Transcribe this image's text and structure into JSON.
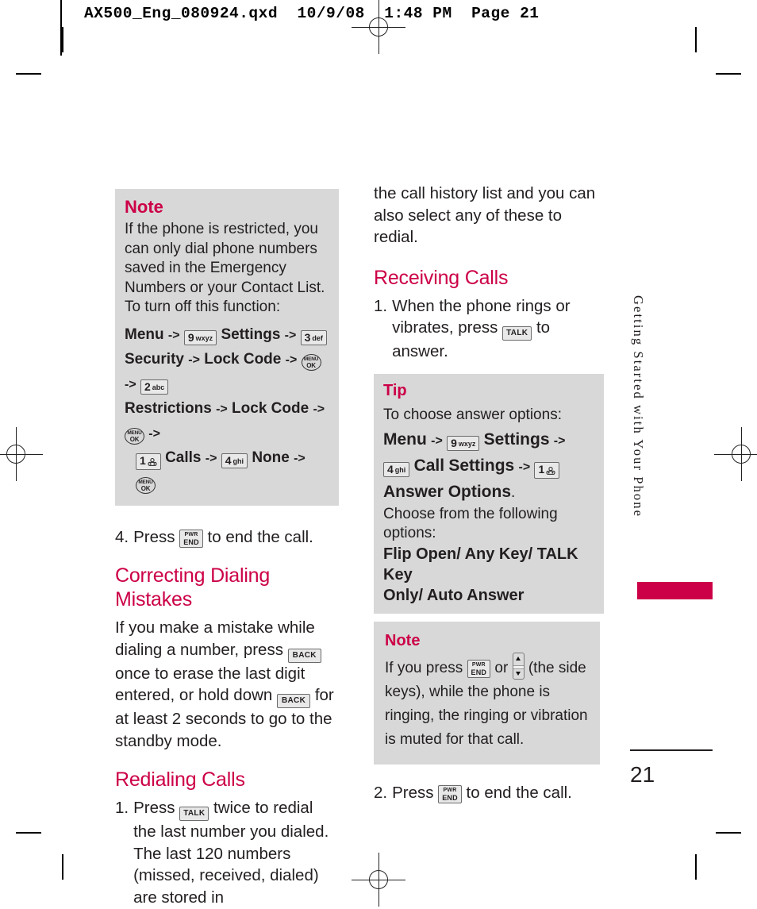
{
  "prepress": {
    "header_line": "AX500_Eng_080924.qxd  10/9/08  1:48 PM  Page 21"
  },
  "left_column": {
    "note_box": {
      "title": "Note",
      "paragraph": "If the phone is restricted, you can only dial phone numbers saved in the Emergency Numbers or your Contact List. To turn off this function:",
      "path_line_1": {
        "menu_label": "Menu",
        "arrow": "->",
        "key_9": {
          "digit": "9",
          "letters": "wxyz"
        },
        "settings_label": "Settings",
        "arrow2": "->",
        "key_3": {
          "digit": "3",
          "letters": "def"
        }
      },
      "path_line_2": {
        "security_label": "Security",
        "arrow": "->",
        "lock_code_label": "Lock Code",
        "arrow2": "->",
        "ok_key": {
          "line1": "MENU",
          "line2": "OK"
        },
        "arrow3": "->",
        "key_2": {
          "digit": "2",
          "letters": "abc"
        }
      },
      "path_line_3": {
        "restrictions_label": "Restrictions",
        "arrow": "->",
        "lock_code_label": "Lock Code",
        "arrow2": "->",
        "ok_key": {
          "line1": "MENU",
          "line2": "OK"
        },
        "arrow3": "->"
      },
      "path_line_4": {
        "key_1": {
          "digit": "1",
          "glyph": "voicemail-icon"
        },
        "calls_label": "Calls",
        "arrow": "->",
        "key_4": {
          "digit": "4",
          "letters": "ghi"
        },
        "none_label": "None",
        "arrow2": "->",
        "ok_key": {
          "line1": "MENU",
          "line2": "OK"
        }
      }
    },
    "step_4": {
      "number": "4.",
      "text_before": "Press",
      "key": {
        "line1": "PWR",
        "line2": "END"
      },
      "text_after": "to end the call."
    },
    "heading_correcting": "Correcting Dialing Mistakes",
    "correcting_paragraph": {
      "part1": "If you make a mistake while dialing a number, press",
      "key1": "BACK",
      "part2": "once to erase the last digit entered, or hold down",
      "key2": "BACK",
      "part3": "for at least 2 seconds to go to the standby mode."
    },
    "heading_redialing": "Redialing Calls",
    "redial_step_1": {
      "number": "1.",
      "text_before": "Press",
      "key": "TALK",
      "text_after": "twice to redial the last number you dialed. The last 120 numbers (missed, received, dialed) are stored in"
    }
  },
  "right_column": {
    "continuation": "the call history list and you can also select any of these to redial.",
    "heading_receiving": "Receiving Calls",
    "receiving_step_1": {
      "number": "1.",
      "text_before": "When the phone rings or vibrates, press",
      "key": "TALK",
      "text_after": "to answer."
    },
    "tip_box": {
      "title": "Tip",
      "intro": "To choose answer options:",
      "menu_label": "Menu",
      "arrow1": "->",
      "key_9": {
        "digit": "9",
        "letters": "wxyz"
      },
      "settings_label": "Settings",
      "arrow2": "->",
      "key_4": {
        "digit": "4",
        "letters": "ghi"
      },
      "call_settings_label_1": "Call",
      "call_settings_label_2": "Settings",
      "arrow3": "->",
      "key_1": {
        "digit": "1",
        "glyph": "voicemail-icon"
      },
      "answer_options_label": "Answer Options",
      "period": ".",
      "choose_line": "Choose from the following options:",
      "options_line_1": "Flip Open/ Any Key/ TALK Key",
      "options_line_2": "Only/ Auto Answer"
    },
    "note_box": {
      "title": "Note",
      "part1": "If you press",
      "key_end": {
        "line1": "PWR",
        "line2": "END"
      },
      "part2": "or",
      "side_key": "volume-rocker-icon",
      "part3": "(the side keys), while the phone is ringing, the ringing or vibration is muted for that call."
    },
    "step_2": {
      "number": "2.",
      "text_before": "Press",
      "key": {
        "line1": "PWR",
        "line2": "END"
      },
      "text_after": "to end the call."
    }
  },
  "running_head": "Getting Started with Your Phone",
  "folio": "21",
  "colors": {
    "accent": "#cc0047",
    "box_bg": "#d8d8d8",
    "text": "#231f20"
  }
}
